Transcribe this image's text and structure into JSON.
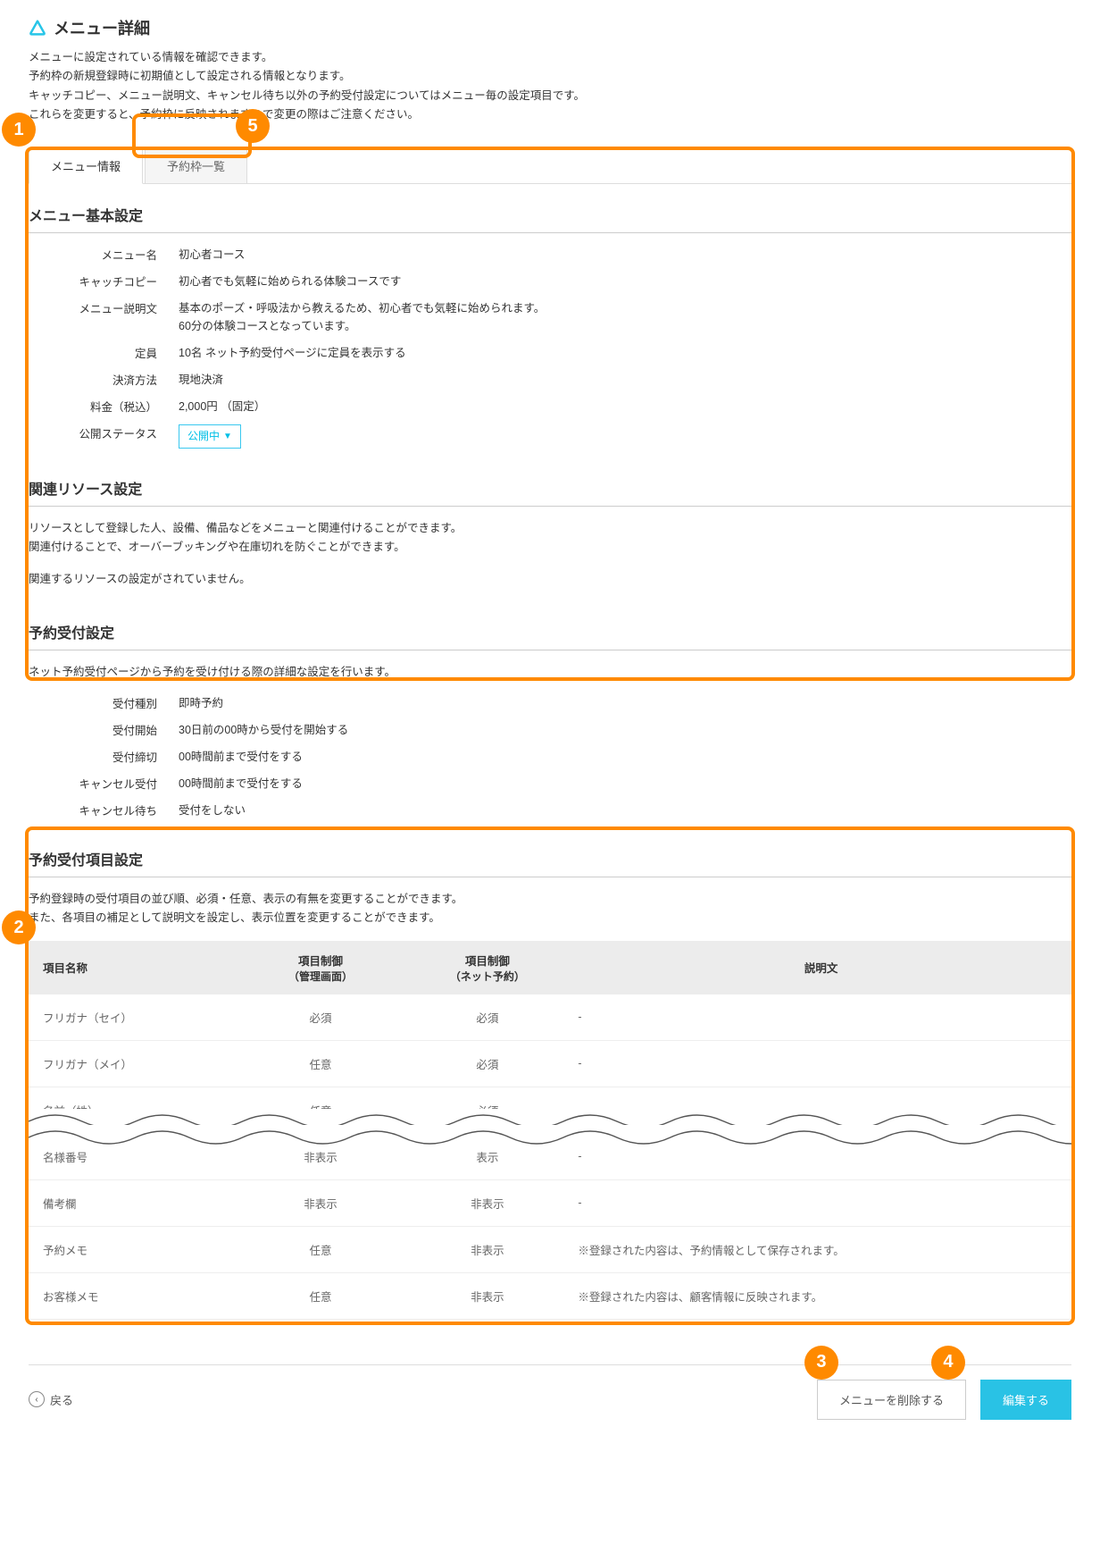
{
  "page": {
    "title": "メニュー詳細",
    "intro": [
      "メニューに設定されている情報を確認できます。",
      "予約枠の新規登録時に初期値として設定される情報となります。",
      "キャッチコピー、メニュー説明文、キャンセル待ち以外の予約受付設定についてはメニュー毎の設定項目です。",
      "これらを変更すると、予約枠に反映されますので変更の際はご注意ください。"
    ]
  },
  "tabs": {
    "menu_info": "メニュー情報",
    "slot_list": "予約枠一覧"
  },
  "basic": {
    "heading": "メニュー基本設定",
    "rows": {
      "name_label": "メニュー名",
      "name_value": "初心者コース",
      "catch_label": "キャッチコピー",
      "catch_value": "初心者でも気軽に始められる体験コースです",
      "desc_label": "メニュー説明文",
      "desc_value_1": "基本のポーズ・呼吸法から教えるため、初心者でも気軽に始められます。",
      "desc_value_2": "60分の体験コースとなっています。",
      "cap_label": "定員",
      "cap_value": "10名 ネット予約受付ページに定員を表示する",
      "pay_label": "決済方法",
      "pay_value": "現地決済",
      "price_label": "料金（税込）",
      "price_value": "2,000円 （固定）",
      "status_label": "公開ステータス",
      "status_value": "公開中"
    }
  },
  "resource": {
    "heading": "関連リソース設定",
    "note1": "リソースとして登録した人、設備、備品などをメニューと関連付けることができます。",
    "note2": "関連付けることで、オーバーブッキングや在庫切れを防ぐことができます。",
    "empty": "関連するリソースの設定がされていません。"
  },
  "reception": {
    "heading": "予約受付設定",
    "note": "ネット予約受付ページから予約を受け付ける際の詳細な設定を行います。",
    "rows": {
      "type_label": "受付種別",
      "type_value": "即時予約",
      "start_label": "受付開始",
      "start_value": "30日前の00時から受付を開始する",
      "end_label": "受付締切",
      "end_value": "00時間前まで受付をする",
      "cancel_label": "キャンセル受付",
      "cancel_value": "00時間前まで受付をする",
      "wait_label": "キャンセル待ち",
      "wait_value": "受付をしない"
    }
  },
  "fields": {
    "heading": "予約受付項目設定",
    "note1": "予約登録時の受付項目の並び順、必須・任意、表示の有無を変更することができます。",
    "note2": "また、各項目の補足として説明文を設定し、表示位置を変更することができます。",
    "thead": {
      "name": "項目名称",
      "admin1": "項目制御",
      "admin2": "（管理画面）",
      "net1": "項目制御",
      "net2": "（ネット予約）",
      "desc": "説明文"
    },
    "rows": [
      {
        "name": "フリガナ（セイ）",
        "admin": "必須",
        "net": "必須",
        "desc": "-"
      },
      {
        "name": "フリガナ（メイ）",
        "admin": "任意",
        "net": "必須",
        "desc": "-"
      },
      {
        "name": "名前（姓）",
        "admin": "任意",
        "net": "必須",
        "desc": "-"
      },
      {
        "name": "名様番号",
        "admin": "非表示",
        "net": "表示",
        "desc": "-"
      },
      {
        "name": "備考欄",
        "admin": "非表示",
        "net": "非表示",
        "desc": "-"
      },
      {
        "name": "予約メモ",
        "admin": "任意",
        "net": "非表示",
        "desc": "※登録された内容は、予約情報として保存されます。"
      },
      {
        "name": "お客様メモ",
        "admin": "任意",
        "net": "非表示",
        "desc": "※登録された内容は、顧客情報に反映されます。"
      }
    ]
  },
  "footer": {
    "back": "戻る",
    "delete": "メニューを削除する",
    "edit": "編集する"
  },
  "annotations": {
    "n1": "1",
    "n2": "2",
    "n3": "3",
    "n4": "4",
    "n5": "5"
  }
}
